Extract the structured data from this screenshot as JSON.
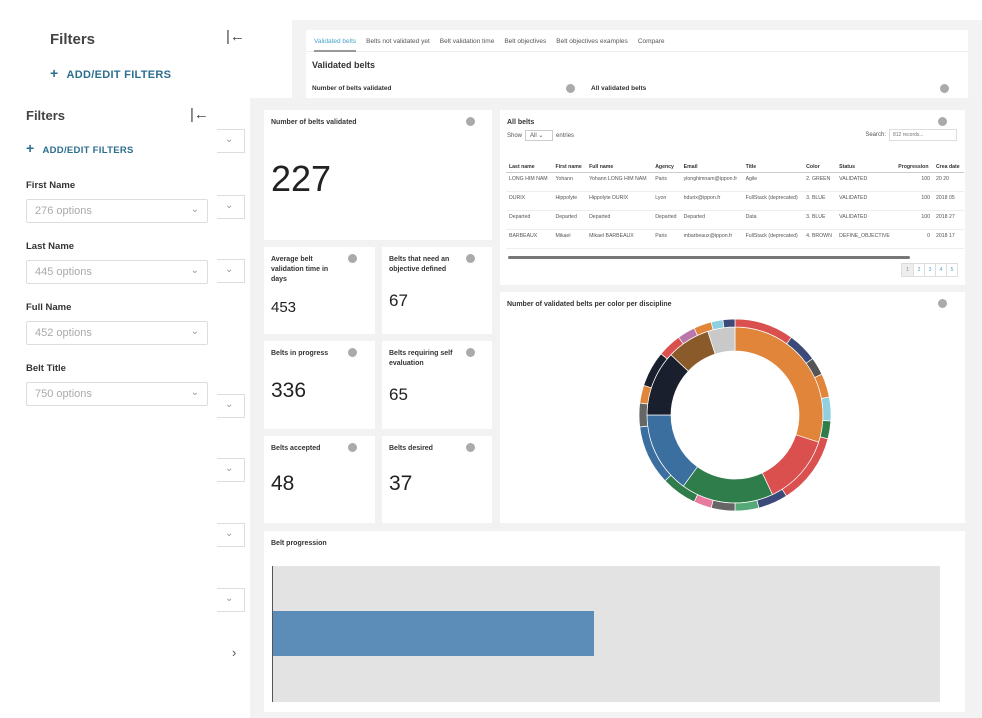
{
  "back": {
    "filters_title": "Filters",
    "add_filters": "ADD/EDIT FILTERS",
    "tabs": [
      "Validated belts",
      "Belts not validated yet",
      "Belt validation time",
      "Belt objectives",
      "Belt objectives examples",
      "Compare"
    ],
    "section_title": "Validated belts",
    "card1": "Number of belts validated",
    "card2": "All validated belts"
  },
  "sidebar": {
    "title": "Filters",
    "add_filters": "ADD/EDIT FILTERS",
    "filters": [
      {
        "label": "First Name",
        "placeholder": "276 options"
      },
      {
        "label": "Last Name",
        "placeholder": "445 options"
      },
      {
        "label": "Full Name",
        "placeholder": "452 options"
      },
      {
        "label": "Belt Title",
        "placeholder": "750 options"
      }
    ]
  },
  "kpis": {
    "validated": {
      "label": "Number of belts validated",
      "value": "227"
    },
    "avg_time": {
      "label": "Average belt validation time in days",
      "value": "453"
    },
    "need_objective": {
      "label": "Belts that need an objective defined",
      "value": "67"
    },
    "in_progress": {
      "label": "Belts in progress",
      "value": "336"
    },
    "self_eval": {
      "label": "Belts requiring self evaluation",
      "value": "65"
    },
    "accepted": {
      "label": "Belts accepted",
      "value": "48"
    },
    "desired": {
      "label": "Belts desired",
      "value": "37"
    }
  },
  "table": {
    "title": "All belts",
    "show": "Show",
    "show_value": "All",
    "entries": "entries",
    "search_label": "Search:",
    "search_placeholder": "812 records...",
    "columns": [
      "Last name",
      "First name",
      "Full name",
      "Agency",
      "Email",
      "Title",
      "Color",
      "Status",
      "Progression",
      "Crea date"
    ],
    "rows": [
      [
        "LONG HIM NAM",
        "Yohann",
        "Yohann LONG HIM NAM",
        "Paris",
        "ylonghimnam@ippon.fr",
        "Agile",
        "2. GREEN",
        "VALIDATED",
        "100",
        "20 20"
      ],
      [
        "DURIX",
        "Hippolyte",
        "Hippolyte DURIX",
        "Lyon",
        "hdurix@ippon.fr",
        "FullStack (deprecated)",
        "3. BLUE",
        "VALIDATED",
        "100",
        "2018 05"
      ],
      [
        "Departed",
        "Departed",
        "Departed",
        "Departed",
        "Departed",
        "Data",
        "3. BLUE",
        "VALIDATED",
        "100",
        "2018 27"
      ],
      [
        "BARBEAUX",
        "Mikael",
        "Mikael BARBEAUX",
        "Paris",
        "mbarbeaux@ippon.fr",
        "FullStack (deprecated)",
        "4. BROWN",
        "DEFINE_OBJECTIVE",
        "0",
        "2018 17"
      ]
    ],
    "pages": [
      "1",
      "2",
      "3",
      "4",
      "5"
    ]
  },
  "chart_data": [
    {
      "type": "pie",
      "title": "Number of validated belts per color per discipline",
      "donut": true,
      "inner_ring": [
        {
          "color": "#e0853a",
          "value": 30
        },
        {
          "color": "#d9504f",
          "value": 13
        },
        {
          "color": "#2f7d4a",
          "value": 17
        },
        {
          "color": "#3a6fa0",
          "value": 15
        },
        {
          "color": "#1a1f2e",
          "value": 12
        },
        {
          "color": "#8a5a2b",
          "value": 8
        },
        {
          "color": "#c9c9c9",
          "value": 5
        }
      ],
      "outer_ring": [
        {
          "color": "#d9504f",
          "value": 10
        },
        {
          "color": "#3b4a78",
          "value": 5
        },
        {
          "color": "#555",
          "value": 3
        },
        {
          "color": "#e0853a",
          "value": 4
        },
        {
          "color": "#8ecfe0",
          "value": 4
        },
        {
          "color": "#2f7d4a",
          "value": 3
        },
        {
          "color": "#d9504f",
          "value": 12
        },
        {
          "color": "#3b4a78",
          "value": 5
        },
        {
          "color": "#5a7",
          "value": 4
        },
        {
          "color": "#666",
          "value": 4
        },
        {
          "color": "#e87aa0",
          "value": 3
        },
        {
          "color": "#2f7d4a",
          "value": 6
        },
        {
          "color": "#3a6fa0",
          "value": 10
        },
        {
          "color": "#666",
          "value": 4
        },
        {
          "color": "#e0853a",
          "value": 3
        },
        {
          "color": "#1a1f2e",
          "value": 6
        },
        {
          "color": "#d9504f",
          "value": 4
        },
        {
          "color": "#b7a",
          "value": 3
        },
        {
          "color": "#e0853a",
          "value": 3
        },
        {
          "color": "#8ecfe0",
          "value": 2
        },
        {
          "color": "#3b4a78",
          "value": 2
        }
      ]
    },
    {
      "type": "bar",
      "title": "Belt progression",
      "orientation": "horizontal",
      "value_fraction": 0.48,
      "bar_color": "#5b8db8"
    }
  ]
}
